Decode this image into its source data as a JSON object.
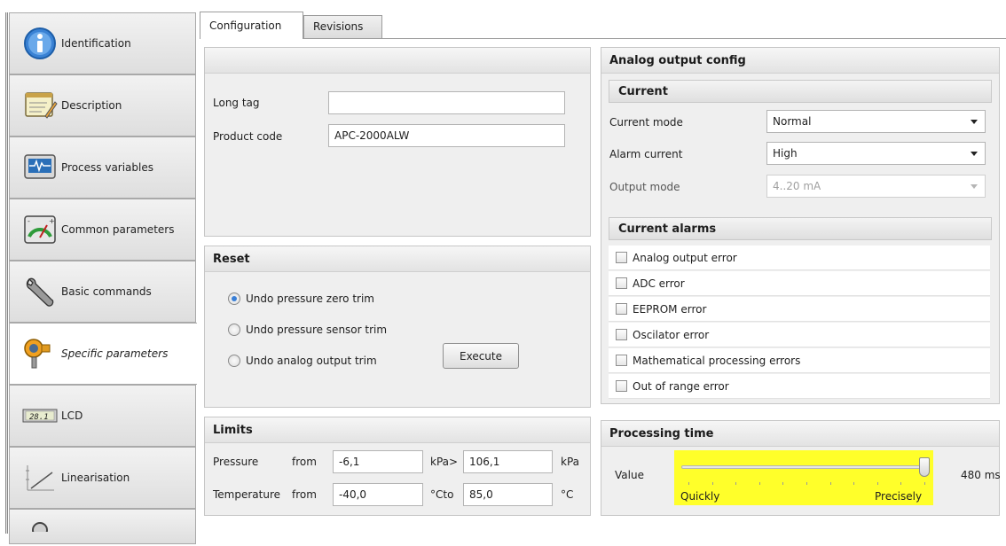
{
  "sidebar": {
    "items": [
      {
        "label": "Identification",
        "icon": "info-icon"
      },
      {
        "label": "Description",
        "icon": "notepad-icon"
      },
      {
        "label": "Process variables",
        "icon": "monitor-wave-icon"
      },
      {
        "label": "Common parameters",
        "icon": "gauge-icon"
      },
      {
        "label": "Basic commands",
        "icon": "wrench-icon"
      },
      {
        "label": "Specific parameters",
        "icon": "pressure-transmitter-icon",
        "active": true
      },
      {
        "label": "LCD",
        "icon": "lcd-display-icon",
        "display_text": "28.1"
      },
      {
        "label": "Linearisation",
        "icon": "chart-line-icon"
      },
      {
        "label": "",
        "icon": "partial-icon"
      }
    ]
  },
  "tabs": [
    {
      "label": "Configuration",
      "active": true
    },
    {
      "label": "Revisions",
      "active": false
    }
  ],
  "identity": {
    "long_tag_label": "Long tag",
    "long_tag_value": "",
    "product_code_label": "Product code",
    "product_code_value": "APC-2000ALW"
  },
  "reset": {
    "title": "Reset",
    "options": [
      {
        "label": "Undo pressure zero trim",
        "selected": true
      },
      {
        "label": "Undo pressure sensor trim",
        "selected": false
      },
      {
        "label": "Undo analog output trim",
        "selected": false
      }
    ],
    "execute_label": "Execute"
  },
  "limits": {
    "title": "Limits",
    "pressure_label": "Pressure",
    "pressure_from_label": "from",
    "pressure_from": "-6,1",
    "pressure_to_label": "kPa>",
    "pressure_to": "106,1",
    "pressure_unit": "kPa",
    "temperature_label": "Temperature",
    "temperature_from_label": "from",
    "temperature_from": "-40,0",
    "temperature_to_label": "°Cto",
    "temperature_to": "85,0",
    "temperature_unit": "°C"
  },
  "analog": {
    "title": "Analog output config",
    "current_title": "Current",
    "current_mode_label": "Current mode",
    "current_mode_value": "Normal",
    "alarm_current_label": "Alarm current",
    "alarm_current_value": "High",
    "output_mode_label": "Output mode",
    "output_mode_value": "4..20 mA",
    "alarms_title": "Current alarms",
    "alarms": [
      {
        "label": "Analog output error",
        "checked": false
      },
      {
        "label": "ADC error",
        "checked": false
      },
      {
        "label": "EEPROM error",
        "checked": false
      },
      {
        "label": "Oscilator error",
        "checked": false
      },
      {
        "label": "Mathematical processing errors",
        "checked": false
      },
      {
        "label": "Out of range error",
        "checked": false
      }
    ]
  },
  "processing": {
    "title": "Processing time",
    "value_label": "Value",
    "slider_position": 1.0,
    "min_label": "Quickly",
    "max_label": "Precisely",
    "readout": "480 ms",
    "highlight_color": "#ffff2a"
  }
}
